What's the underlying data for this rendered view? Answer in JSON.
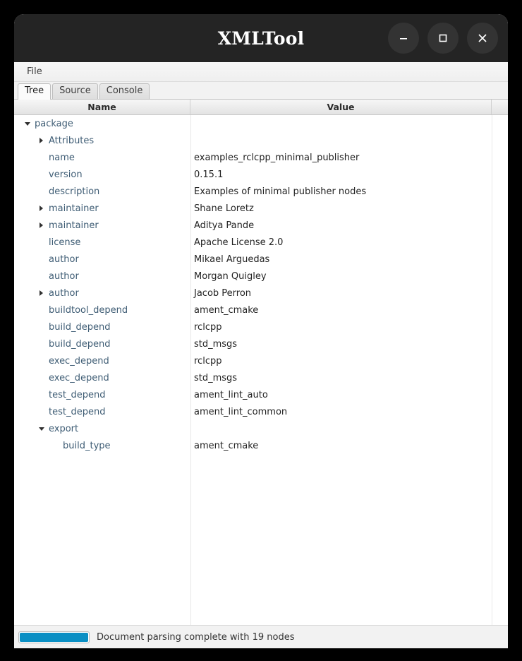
{
  "window": {
    "title": "XMLTool",
    "controls": [
      {
        "name": "minimize-button",
        "icon": "minimize-icon"
      },
      {
        "name": "maximize-button",
        "icon": "maximize-icon"
      },
      {
        "name": "close-button",
        "icon": "close-icon"
      }
    ]
  },
  "menubar": {
    "items": [
      {
        "label": "File"
      }
    ]
  },
  "tabs": [
    {
      "label": "Tree",
      "active": true
    },
    {
      "label": "Source",
      "active": false
    },
    {
      "label": "Console",
      "active": false
    }
  ],
  "tree": {
    "columns": [
      {
        "label": "Name"
      },
      {
        "label": "Value"
      },
      {
        "label": ""
      }
    ],
    "rows": [
      {
        "indent": 0,
        "twisty": "open",
        "name": "package",
        "value": ""
      },
      {
        "indent": 1,
        "twisty": "closed",
        "name": "Attributes",
        "value": ""
      },
      {
        "indent": 1,
        "twisty": "none",
        "name": "name",
        "value": "examples_rclcpp_minimal_publisher"
      },
      {
        "indent": 1,
        "twisty": "none",
        "name": "version",
        "value": "0.15.1"
      },
      {
        "indent": 1,
        "twisty": "none",
        "name": "description",
        "value": "Examples of minimal publisher nodes"
      },
      {
        "indent": 1,
        "twisty": "closed",
        "name": "maintainer",
        "value": "Shane Loretz"
      },
      {
        "indent": 1,
        "twisty": "closed",
        "name": "maintainer",
        "value": "Aditya Pande"
      },
      {
        "indent": 1,
        "twisty": "none",
        "name": "license",
        "value": "Apache License 2.0"
      },
      {
        "indent": 1,
        "twisty": "none",
        "name": "author",
        "value": "Mikael Arguedas"
      },
      {
        "indent": 1,
        "twisty": "none",
        "name": "author",
        "value": "Morgan Quigley"
      },
      {
        "indent": 1,
        "twisty": "closed",
        "name": "author",
        "value": "Jacob Perron"
      },
      {
        "indent": 1,
        "twisty": "none",
        "name": "buildtool_depend",
        "value": "ament_cmake"
      },
      {
        "indent": 1,
        "twisty": "none",
        "name": "build_depend",
        "value": "rclcpp"
      },
      {
        "indent": 1,
        "twisty": "none",
        "name": "build_depend",
        "value": "std_msgs"
      },
      {
        "indent": 1,
        "twisty": "none",
        "name": "exec_depend",
        "value": "rclcpp"
      },
      {
        "indent": 1,
        "twisty": "none",
        "name": "exec_depend",
        "value": "std_msgs"
      },
      {
        "indent": 1,
        "twisty": "none",
        "name": "test_depend",
        "value": "ament_lint_auto"
      },
      {
        "indent": 1,
        "twisty": "none",
        "name": "test_depend",
        "value": "ament_lint_common"
      },
      {
        "indent": 1,
        "twisty": "open",
        "name": "export",
        "value": ""
      },
      {
        "indent": 2,
        "twisty": "none",
        "name": "build_type",
        "value": "ament_cmake"
      }
    ]
  },
  "statusbar": {
    "progress_percent": 100,
    "message": "Document parsing complete with 19 nodes"
  },
  "colors": {
    "titlebar_bg": "#242424",
    "progress_fill": "#0a8fc4",
    "node_label": "#3e5c74"
  }
}
